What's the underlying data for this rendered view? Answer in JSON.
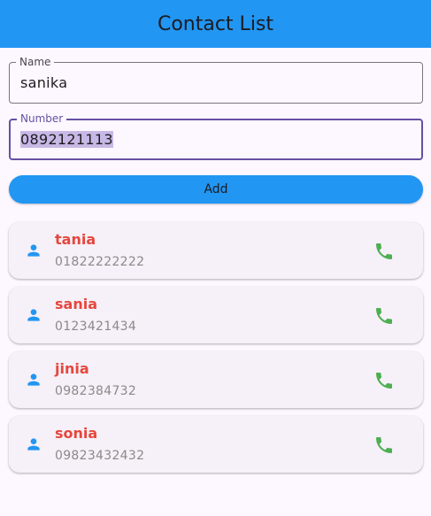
{
  "appbar": {
    "title": "Contact List",
    "color": "#2196f3"
  },
  "form": {
    "name_label": "Name",
    "name_value": "sanika",
    "number_label": "Number",
    "number_value": "0892121113",
    "add_label": "Add"
  },
  "contacts": [
    {
      "name": "tania",
      "number": "01822222222",
      "icon": "person-icon",
      "action_icon": "phone-icon"
    },
    {
      "name": "sania",
      "number": "0123421434",
      "icon": "person-icon",
      "action_icon": "phone-icon"
    },
    {
      "name": "jinia",
      "number": "0982384732",
      "icon": "person-icon",
      "action_icon": "phone-icon"
    },
    {
      "name": "sonia",
      "number": "09823432432",
      "icon": "person-icon",
      "action_icon": "phone-icon"
    }
  ],
  "colors": {
    "name_text": "#e5473d",
    "person_icon": "#2196f3",
    "phone_icon": "#4caf50",
    "focus_border": "#6750a4"
  }
}
